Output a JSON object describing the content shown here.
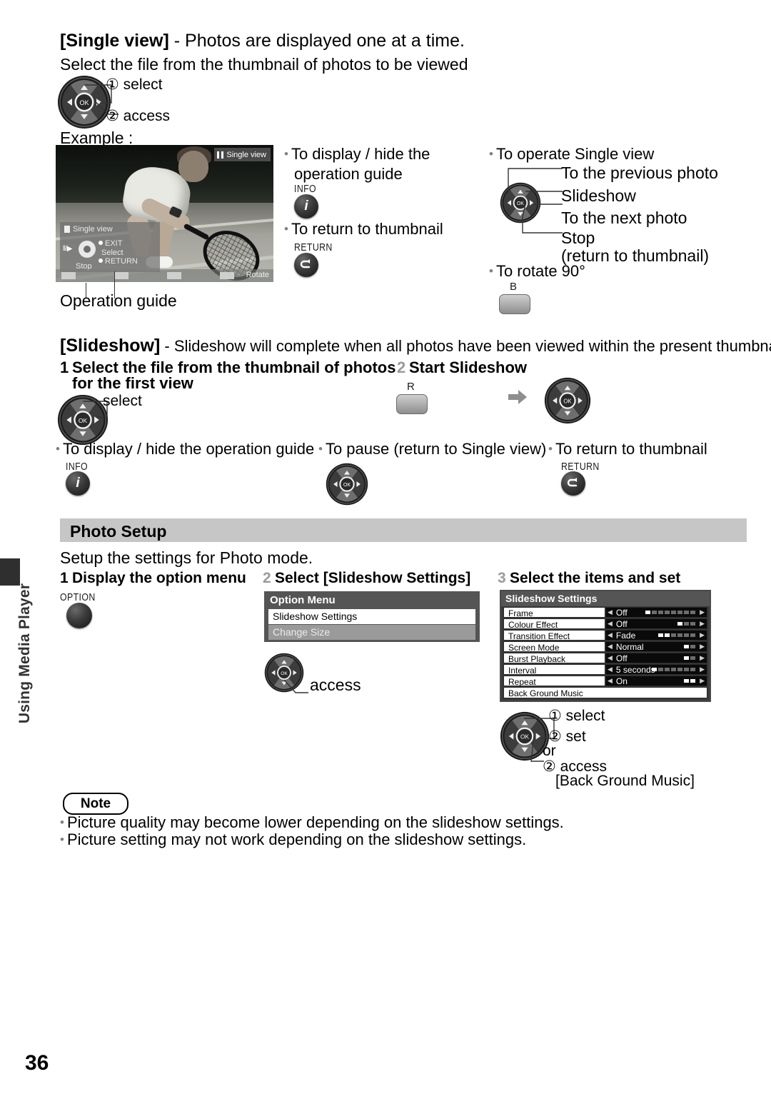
{
  "sidebar": {
    "chapter_label": "Using Media Player"
  },
  "page_number": "36",
  "single_view": {
    "heading_bracket": "[Single view]",
    "heading_rest": " - Photos are displayed one at a time.",
    "subtitle": "Select the file from the thumbnail of photos to be viewed",
    "callout_select": "① select",
    "callout_access": "② access",
    "example_label": "Example :",
    "operation_guide_label": "Operation guide",
    "tv": {
      "status_badge": "Single view",
      "guide_title": "Single view",
      "guide_playpause": "ll/▶",
      "guide_exit": "EXIT",
      "guide_select": "Select",
      "guide_return": "RETURN",
      "guide_stop": "Stop",
      "bottom_rotate": "Rotate"
    },
    "mid_col": {
      "b1": "To display / hide the",
      "b1_line2": "operation guide",
      "info_cap": "INFO",
      "b2": "To return to thumbnail",
      "return_cap": "RETURN"
    },
    "right_col": {
      "b1": "To operate Single view",
      "l1": "To the previous photo",
      "l2": "Slideshow",
      "l3": "To the next photo",
      "l4": "Stop",
      "l4b": "(return to thumbnail)",
      "b2": "To rotate 90°",
      "btn_b_cap": "B"
    }
  },
  "slideshow": {
    "heading_bracket": "[Slideshow]",
    "heading_rest": " - Slideshow will complete when all photos have been viewed within the present thumbnail.",
    "step1_num": "1",
    "step1_line1": "Select the file from the thumbnail of photos",
    "step1_line2": "for the first view",
    "step1_select": "select",
    "step2_num": "2",
    "step2_label": "Start Slideshow",
    "btn_r_cap": "R",
    "b1": "To display / hide the operation guide",
    "b1_cap": "INFO",
    "b2": "To pause (return to Single view)",
    "b3": "To return to thumbnail",
    "b3_cap": "RETURN"
  },
  "photo_setup": {
    "section_title": "Photo Setup",
    "intro": "Setup the settings for Photo mode.",
    "step1_num": "1",
    "step1_label": "Display the option menu",
    "option_btn_cap": "OPTION",
    "step2_num": "2",
    "step2_label": "Select [Slideshow Settings]",
    "access_label": "access",
    "step3_num": "3",
    "step3_label": "Select the items and set",
    "option_menu": {
      "title": "Option Menu",
      "items": [
        {
          "label": "Slideshow Settings",
          "state": "selected"
        },
        {
          "label": "Change Size",
          "state": "dim"
        }
      ]
    },
    "slideshow_settings": {
      "title": "Slideshow Settings",
      "rows": [
        {
          "label": "Frame",
          "value": "Off",
          "segments": 8,
          "on": 1
        },
        {
          "label": "Colour Effect",
          "value": "Off",
          "segments": 3,
          "on": 1
        },
        {
          "label": "Transition Effect",
          "value": "Fade",
          "segments": 6,
          "on": 2
        },
        {
          "label": "Screen Mode",
          "value": "Normal",
          "segments": 2,
          "on": 1
        },
        {
          "label": "Burst Playback",
          "value": "Off",
          "segments": 2,
          "on": 1
        },
        {
          "label": "Interval",
          "value": "5 seconds",
          "segments": 7,
          "on": 1
        },
        {
          "label": "Repeat",
          "value": "On",
          "segments": 2,
          "on": 2
        }
      ],
      "last_row": "Back Ground Music"
    },
    "callout_select": "① select",
    "callout_set": "② set",
    "callout_or": "or",
    "callout_access": "② access",
    "callout_bgm": "[Back Ground Music]"
  },
  "note": {
    "title": "Note",
    "items": [
      "Picture quality may become lower depending on the slideshow settings.",
      "Picture setting may not work depending on the slideshow settings."
    ]
  },
  "colors": {
    "band": "#c6c6c6",
    "panel_dark": "#3a3a3a",
    "menu_grey": "#555555",
    "bullet_grey": "#808080"
  }
}
